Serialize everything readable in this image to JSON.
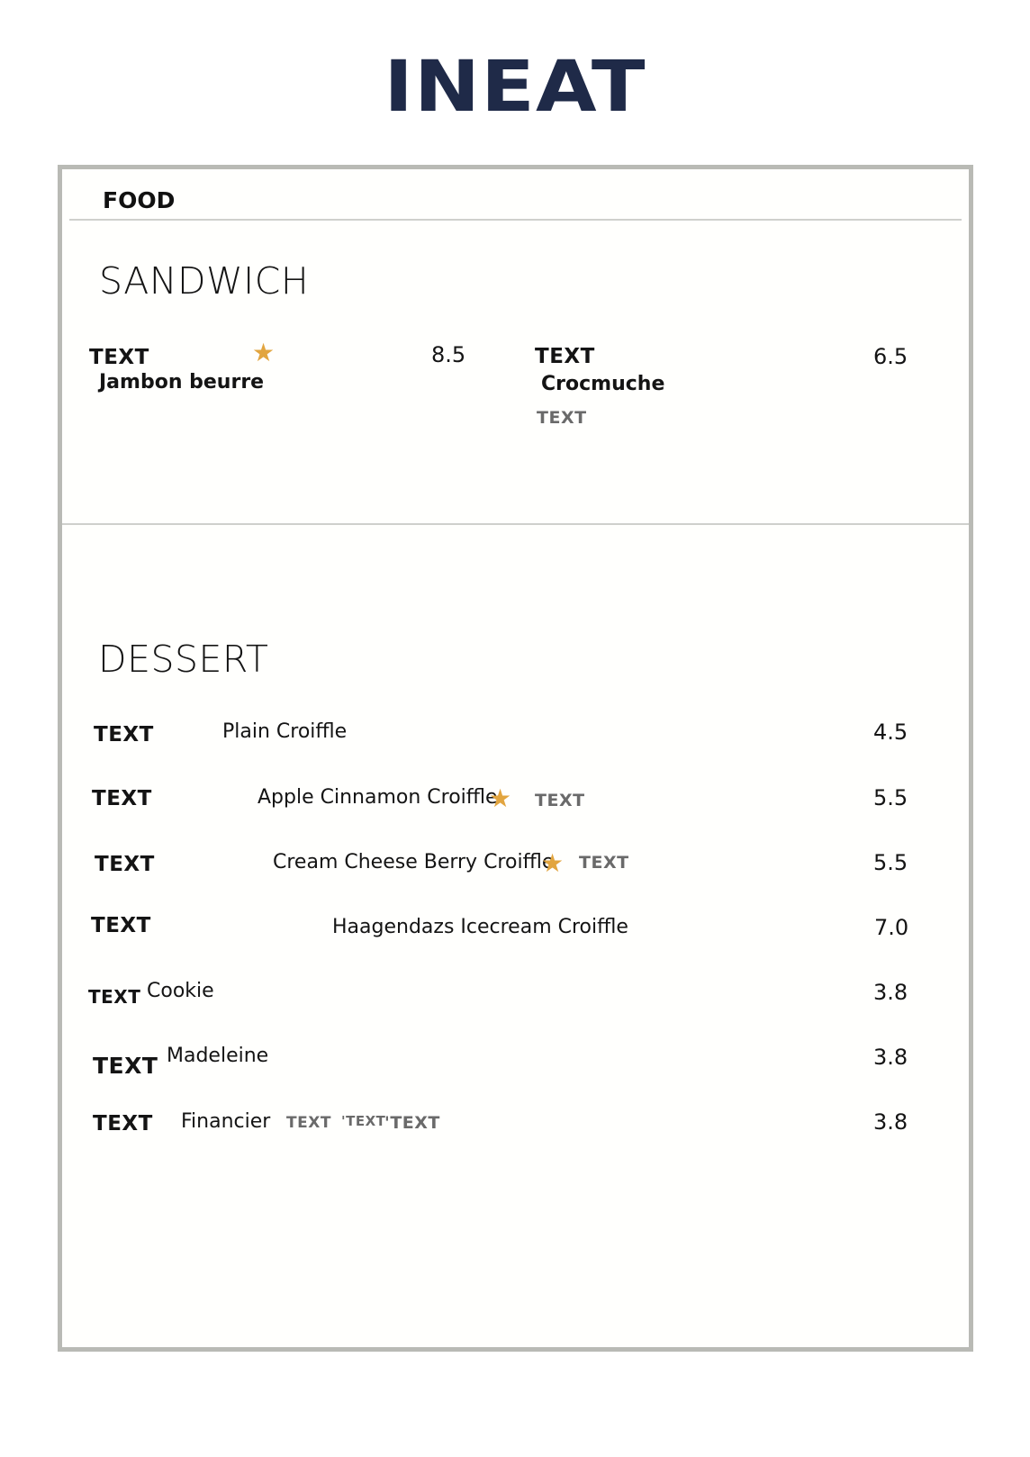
{
  "brand": {
    "logo_text": "INEAT",
    "logo_color": "#1f2a48"
  },
  "menu": {
    "tab_label": "FOOD",
    "sandwich": {
      "title": "SANDWICH",
      "items": [
        {
          "tag": "TEXT",
          "name": "Jambon beurre",
          "star": "★",
          "price": "8.5"
        },
        {
          "tag": "TEXT",
          "name": "Crocmuche",
          "note": "TEXT",
          "price": "6.5"
        }
      ]
    },
    "dessert": {
      "title": "DESSERT",
      "items": [
        {
          "tag": "TEXT",
          "name": "Plain Croiffle",
          "price": "4.5"
        },
        {
          "tag": "TEXT",
          "name": "Apple Cinnamon Croiffle",
          "star": "★",
          "note": "TEXT",
          "price": "5.5"
        },
        {
          "tag": "TEXT",
          "name": "Cream Cheese Berry Croiffle",
          "star": "★",
          "note": "TEXT",
          "price": "5.5"
        },
        {
          "tag": "TEXT",
          "name": "Haagendazs Icecream Croiffle",
          "price": "7.0"
        },
        {
          "tag": "TEXT",
          "name": "Cookie",
          "price": "3.8"
        },
        {
          "tag": "TEXT",
          "name": "Madeleine",
          "price": "3.8"
        },
        {
          "tag": "TEXT",
          "name": "Financier",
          "notes": [
            "TEXT",
            "'TEXT",
            "'TEXT"
          ],
          "price": "3.8"
        }
      ]
    }
  },
  "colors": {
    "star": "#e2a53f",
    "frame_border": "#b9bab5",
    "muted_text": "#6a6a6a"
  },
  "icons": {
    "featured": "star-icon"
  }
}
